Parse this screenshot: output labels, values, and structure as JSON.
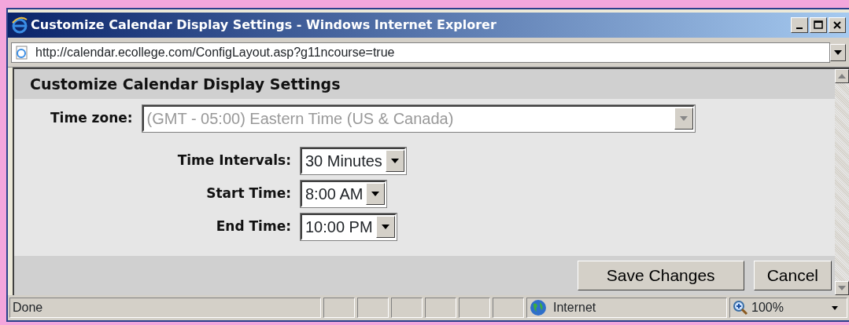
{
  "window": {
    "title": "Customize Calendar Display Settings - Windows Internet Explorer"
  },
  "address_bar": {
    "url": "http://calendar.ecollege.com/ConfigLayout.asp?g11ncourse=true"
  },
  "page": {
    "heading": "Customize Calendar Display Settings",
    "fields": [
      {
        "kind": "wide",
        "label": "Time zone:",
        "value": "(GMT - 05:00) Eastern Time (US & Canada)",
        "disabled": true
      },
      {
        "kind": "narrow",
        "label": "Time Intervals:",
        "value": "30 Minutes",
        "disabled": false
      },
      {
        "kind": "narrow",
        "label": "Start Time:",
        "value": "8:00 AM",
        "disabled": false
      },
      {
        "kind": "narrow",
        "label": "End Time:",
        "value": "10:00 PM",
        "disabled": false
      }
    ],
    "buttons": [
      "Save Changes",
      "Cancel"
    ]
  },
  "status_bar": {
    "text": "Done",
    "zone": "Internet",
    "zoom": "100%"
  }
}
